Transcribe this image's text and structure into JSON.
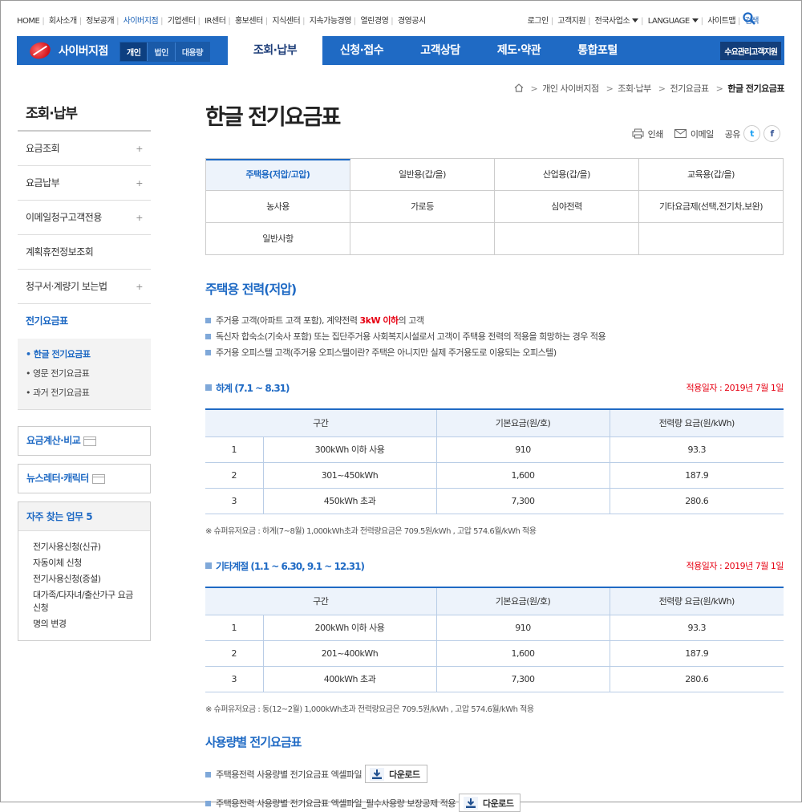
{
  "util_nav": {
    "left": [
      "HOME",
      "회사소개",
      "정보공개",
      "사이버지점",
      "기업센터",
      "IR센터",
      "홍보센터",
      "지식센터",
      "지속가능경영",
      "열린경영",
      "경영공시"
    ],
    "active_left": "사이버지점",
    "login": "로그인",
    "support": "고객지원",
    "branches": "전국사업소",
    "language": "LANGUAGE",
    "sitemap": "사이트맵",
    "search": "검색"
  },
  "gnb": {
    "logo": "사이버지점",
    "segments": [
      "개인",
      "법인",
      "대용량"
    ],
    "active_segment": "개인",
    "menu": [
      "조회·납부",
      "신청·접수",
      "고객상담",
      "제도·약관",
      "통합포털"
    ],
    "active_menu": "조회·납부",
    "right_button": "수요관리고객지원"
  },
  "breadcrumb": [
    "개인 사이버지점",
    "조회·납부",
    "전기요금표",
    "한글 전기요금표"
  ],
  "lnb": {
    "title": "조회·납부",
    "items": [
      {
        "label": "요금조회",
        "plus": "+"
      },
      {
        "label": "요금납부",
        "plus": "+"
      },
      {
        "label": "이메일청구고객전용",
        "plus": "+"
      },
      {
        "label": "계획휴전정보조회",
        "plus": ""
      },
      {
        "label": "청구서·계량기 보는법",
        "plus": "+"
      }
    ],
    "active_item": "전기요금표",
    "sub": [
      "한글 전기요금표",
      "영문 전기요금표",
      "과거 전기요금표"
    ],
    "box1": "요금계산·비교",
    "box2": "뉴스레터·캐릭터",
    "faq_title": "자주 찾는 업무 5",
    "faq": [
      "전기사용신청(신규)",
      "자동이체 신청",
      "전기사용신청(증설)",
      "대가족/다자녀/출산가구 요금 신청",
      "명의 변경"
    ]
  },
  "page": {
    "title": "한글 전기요금표",
    "print": "인쇄",
    "email": "이메일",
    "share": "공유",
    "twitter": "t",
    "facebook": "f"
  },
  "tabs": [
    "주택용(저압/고압)",
    "일반용(갑/을)",
    "산업용(갑/을)",
    "교육용(갑/을)",
    "농사용",
    "가로등",
    "심야전력",
    "기타요금제(선택,전기차,보완)",
    "일반사항",
    "",
    "",
    ""
  ],
  "active_tab": "주택용(저압/고압)",
  "section": {
    "title": "주택용 전력(저압)",
    "bullet1_a": "주거용 고객(아파트 고객 포함), 계약전력 ",
    "bullet1_b": "3kW 이하",
    "bullet1_c": "의 고객",
    "bullet2": "독신자 합숙소(기숙사 포함) 또는 집단주거용 사회복지시설로서 고객이 주택용 전력의 적용을 희망하는 경우 적용",
    "bullet3": "주거용 오피스텔 고객(주거용 오피스텔이란? 주택은 아니지만 실제 주거용도로 이용되는 오피스텔)"
  },
  "summer": {
    "label": "하계 (7.1 ~ 8.31)",
    "date": "적용일자 : 2019년 7월 1일",
    "headers": [
      "구간",
      "기본요금(원/호)",
      "전력량 요금(원/kWh)"
    ],
    "rows": [
      [
        "1",
        "300kWh 이하 사용",
        "910",
        "93.3"
      ],
      [
        "2",
        "301~450kWh",
        "1,600",
        "187.9"
      ],
      [
        "3",
        "450kWh 초과",
        "7,300",
        "280.6"
      ]
    ],
    "note": "※  슈퍼유저요금 : 하계(7~8월) 1,000kWh초과 전력량요금은 709.5원/kWh , 고압 574.6월/kWh 적용"
  },
  "other": {
    "label": "기타계절 (1.1 ~ 6.30, 9.1 ~ 12.31)",
    "date": "적용일자 : 2019년 7월 1일",
    "headers": [
      "구간",
      "기본요금(원/호)",
      "전력량 요금(원/kWh)"
    ],
    "rows": [
      [
        "1",
        "200kWh 이하 사용",
        "910",
        "93.3"
      ],
      [
        "2",
        "201~400kWh",
        "1,600",
        "187.9"
      ],
      [
        "3",
        "400kWh 초과",
        "7,300",
        "280.6"
      ]
    ],
    "note": "※  슈퍼유저요금 : 동(12~2월) 1,000kWh초과 전력량요금은 709.5원/kWh , 고압 574.6월/kWh 적용"
  },
  "usage": {
    "title": "사용량별 전기요금표",
    "row1": "주택용전력 사용량별 전기요금표 엑셀파일",
    "row2": "주택용전력 사용량별 전기요금표 엑셀파일_필수사용량 보장공제 적용",
    "download": "다운로드"
  },
  "colors": {
    "brand": "#1f6ac4",
    "accent_red": "#e60012",
    "table_head": "#edf3fb"
  }
}
